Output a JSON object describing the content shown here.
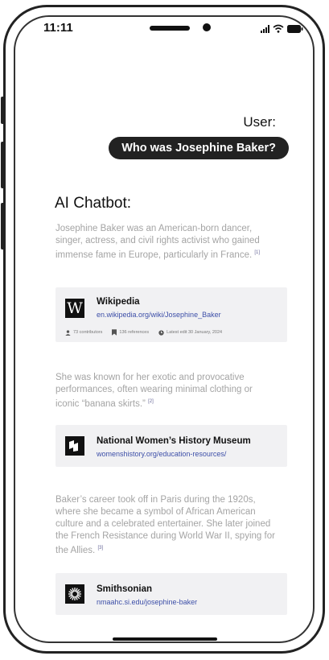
{
  "status_bar": {
    "time": "11:11"
  },
  "conversation": {
    "user_label": "User:",
    "user_question": "Who was Josephine Baker?",
    "bot_label": "AI Chatbot:",
    "messages": [
      {
        "text": "Josephine Baker was an American-born dancer, singer, actress, and civil rights activist who gained immense fame in Europe, particularly in France.",
        "citation": "[1]"
      },
      {
        "text": "She was known for her exotic and provocative performances, often wearing minimal clothing or iconic “banana skirts.”",
        "citation": "[2]"
      },
      {
        "text": "Baker’s career took off in Paris during the 1920s, where she became a symbol of African American culture and a celebrated entertainer. She later joined the French Resistance during World War II, spying for the Allies.",
        "citation": "[3]"
      }
    ],
    "sources": [
      {
        "icon": "wikipedia-logo",
        "title": "Wikipedia",
        "url": "en.wikipedia.org/wiki/Josephine_Baker",
        "contributors": "73 contributors",
        "references": "136 references",
        "last_edit": "Latest edit 30 January, 2024"
      },
      {
        "icon": "nwhm-logo",
        "title": "National Women’s History Museum",
        "url": "womenshistory.org/education-resources/"
      },
      {
        "icon": "smithsonian-logo",
        "title": "Smithsonian",
        "url": "nmaahc.si.edu/josephine-baker"
      }
    ]
  },
  "colors": {
    "bubble": "#222222",
    "body_text": "#a4a4a4",
    "link": "#3d4fa8",
    "card_bg": "#f1f1f3"
  }
}
